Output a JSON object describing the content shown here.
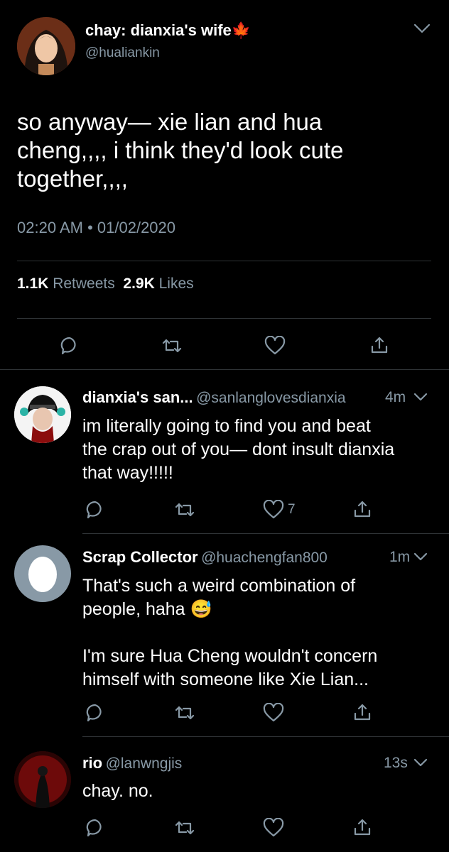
{
  "main_tweet": {
    "display_name": "chay: dianxia's wife",
    "name_emoji": "🍁",
    "handle": "@hualiankin",
    "text": "so anyway— xie lian and hua\ncheng,,,, i think they'd look cute\ntogether,,,,",
    "time": "02:20 AM",
    "date": "01/02/2020",
    "retweets_count": "1.1K",
    "retweets_label": "Retweets",
    "likes_count": "2.9K",
    "likes_label": "Likes"
  },
  "replies": [
    {
      "display_name": "dianxia's san...",
      "handle": "@sanlanglovesdianxia",
      "time": "4m",
      "text": "im literally going to find you and beat\nthe crap out of you— dont insult dianxia\nthat way!!!!!",
      "like_count": "7"
    },
    {
      "display_name": "Scrap Collector",
      "handle": "@huachengfan800",
      "time": "1m",
      "text": "That's such a weird combination of\npeople, haha 😅\n\nI'm sure Hua Cheng wouldn't concern\nhimself with someone like Xie Lian...",
      "like_count": ""
    },
    {
      "display_name": "rio",
      "handle": "@lanwngjis",
      "time": "13s",
      "text": "chay. no.",
      "like_count": ""
    }
  ],
  "icons": [
    "chevron-down-icon",
    "reply-icon",
    "retweet-icon",
    "like-icon",
    "share-icon"
  ],
  "colors": {
    "background": "#000000",
    "text": "#ffffff",
    "secondary": "#8899a6",
    "divider": "#2f3336"
  }
}
